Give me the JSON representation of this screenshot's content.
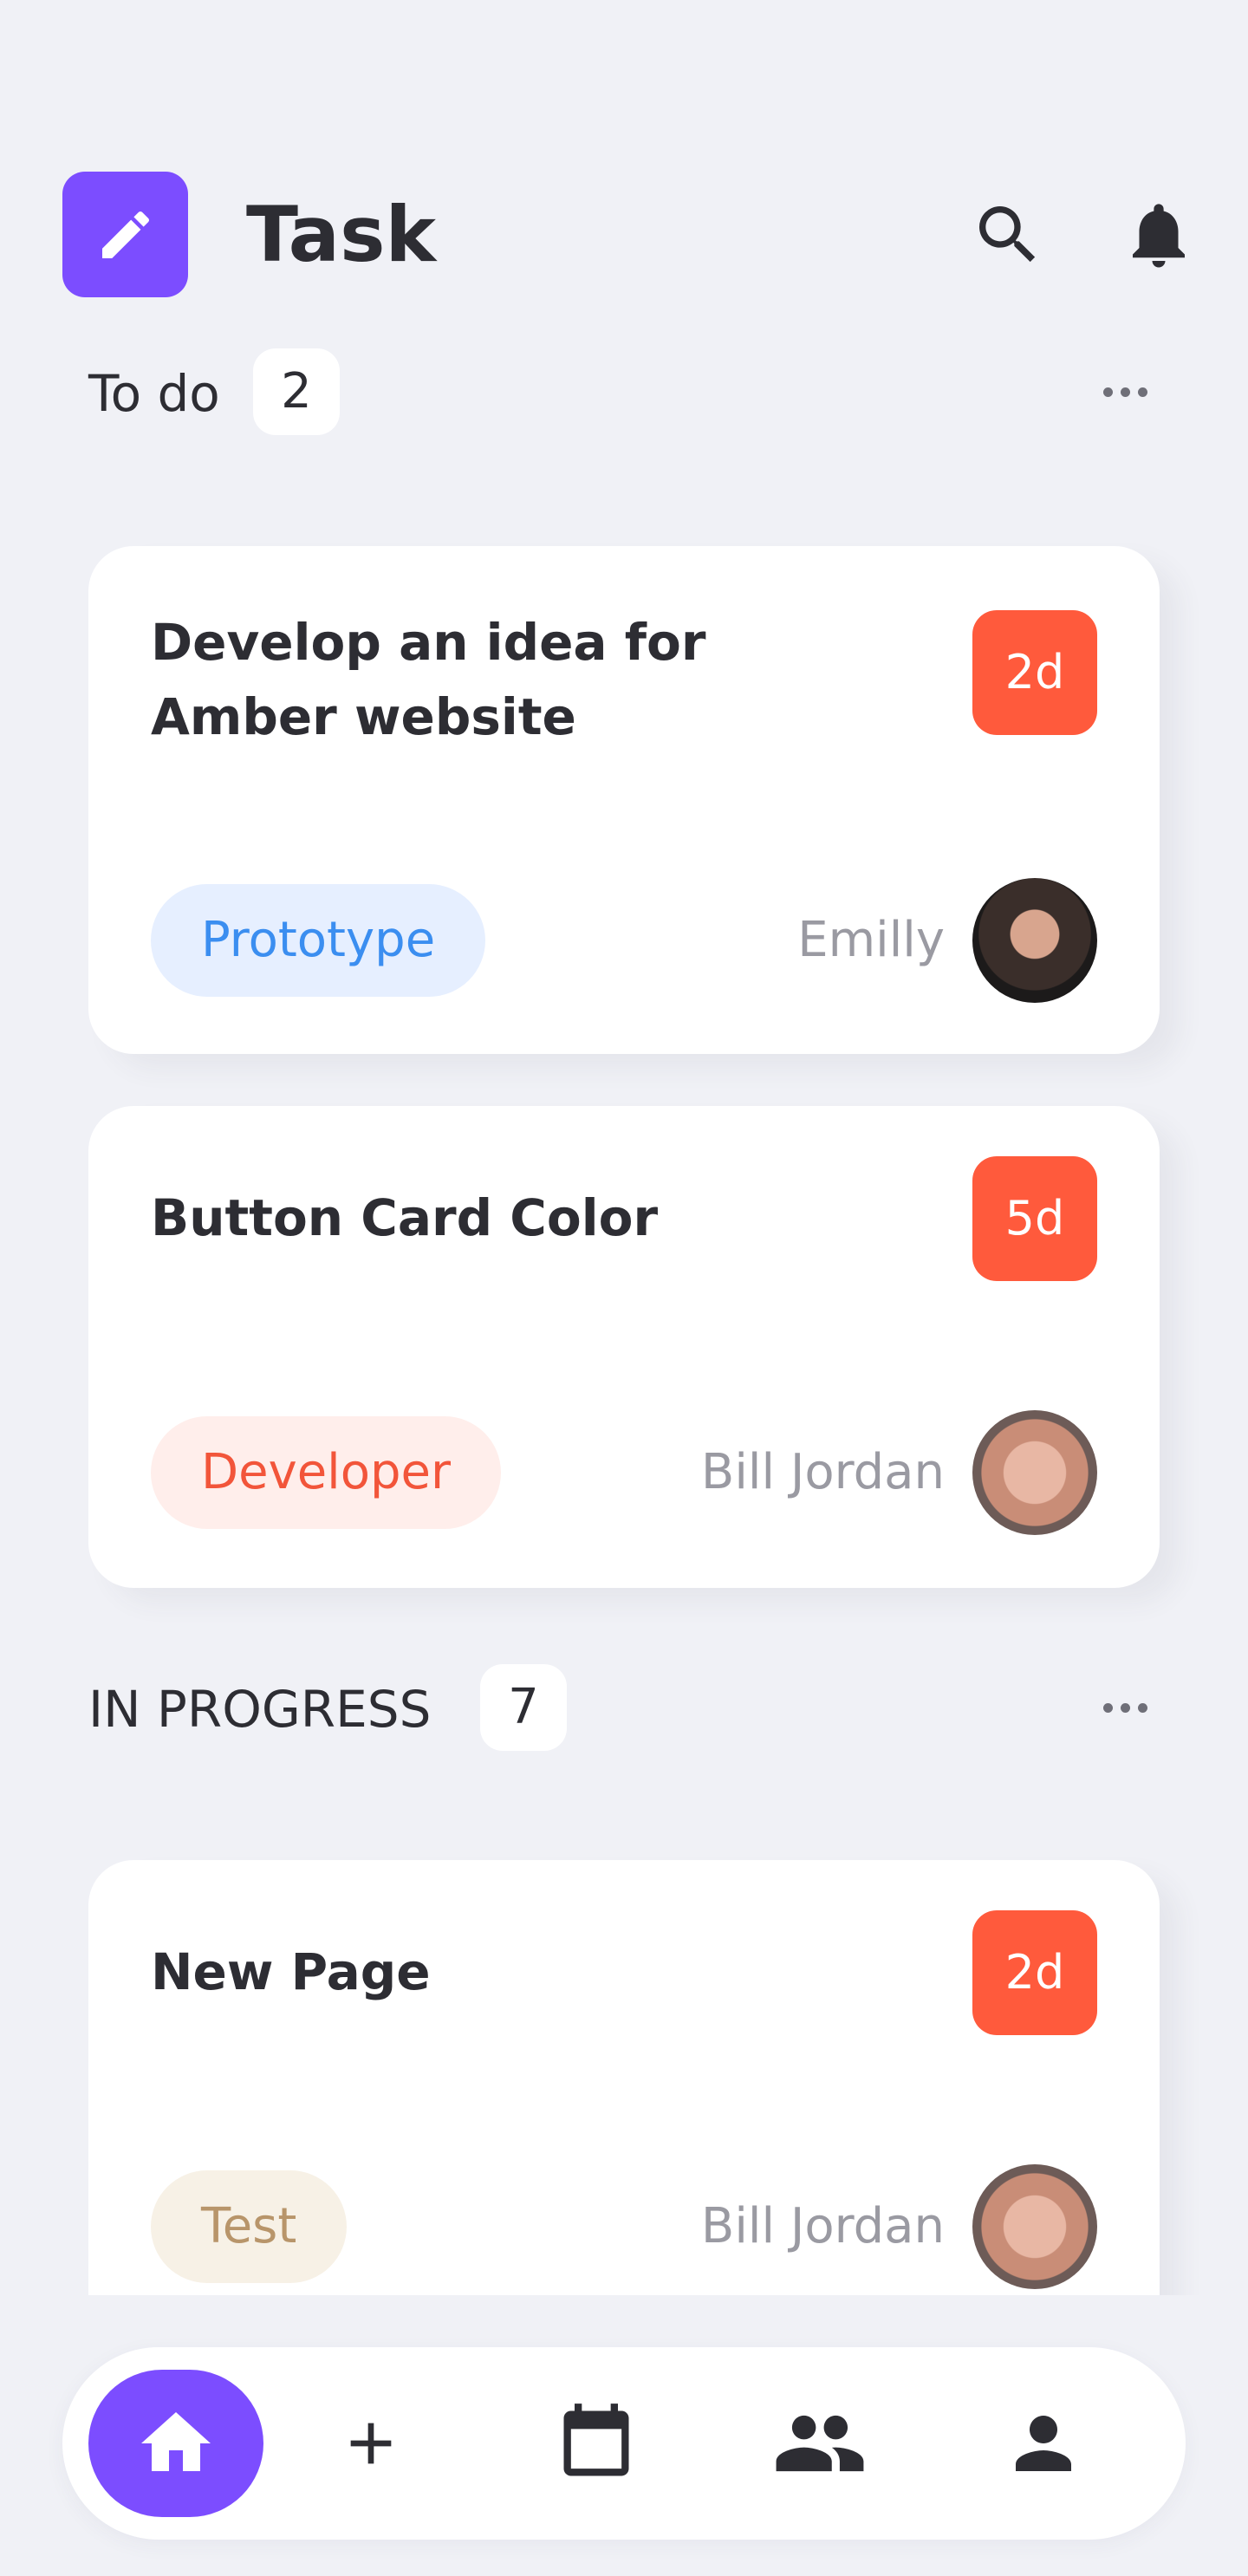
{
  "app": {
    "title": "Task",
    "accent_color": "#7c4dff",
    "icon": "pencil-icon"
  },
  "header": {
    "search_icon": "search-icon",
    "bell_icon": "bell-icon"
  },
  "sections": [
    {
      "title": "To do",
      "count": "2",
      "cards": [
        {
          "title": "Develop an idea for Amber website",
          "days": "2d",
          "tag": "Prototype",
          "assignee": "Emilly"
        },
        {
          "title": "Button Card Color",
          "days": "5d",
          "tag": "Developer",
          "assignee": "Bill Jordan"
        }
      ]
    },
    {
      "title": "IN PROGRESS",
      "count": "7",
      "cards": [
        {
          "title": "New Page",
          "days": "2d",
          "tag": "Test",
          "assignee": "Bill Jordan"
        }
      ]
    }
  ],
  "colors": {
    "badge": "#ff5a3c",
    "prototype_tag": "#3b8ef0",
    "developer_tag": "#f2553a",
    "test_tag": "#b8956a"
  },
  "bottom_nav": {
    "items": [
      "home-icon",
      "plus-icon",
      "calendar-icon",
      "people-icon",
      "person-icon"
    ],
    "active": "home-icon"
  }
}
